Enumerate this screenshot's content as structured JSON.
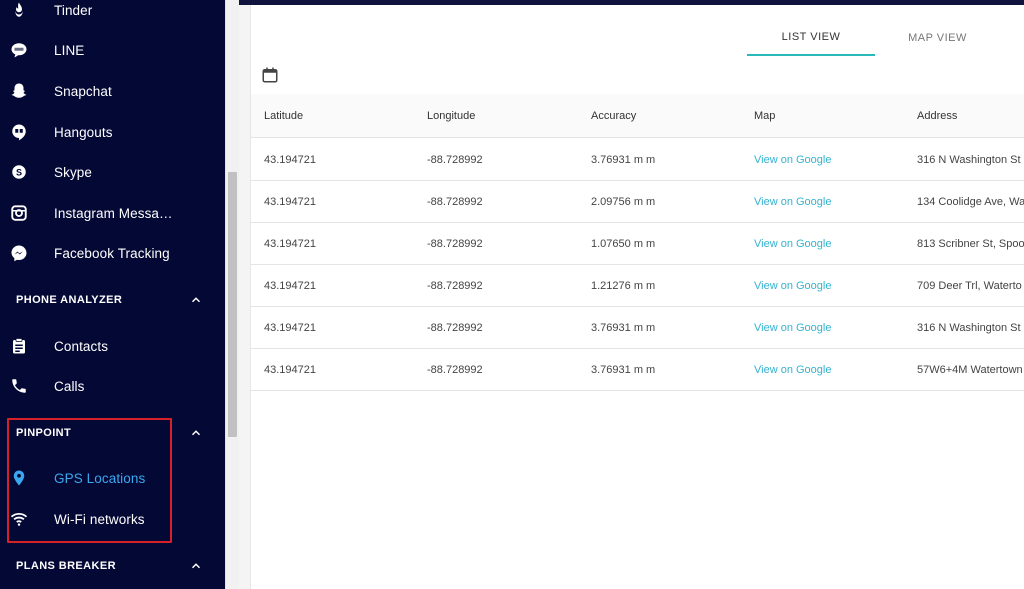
{
  "sidebar": {
    "apps": [
      {
        "label": "Tinder",
        "icon": "tinder-flame-icon"
      },
      {
        "label": "LINE",
        "icon": "line-bubble-icon"
      },
      {
        "label": "Snapchat",
        "icon": "snapchat-ghost-icon"
      },
      {
        "label": "Hangouts",
        "icon": "hangouts-quote-icon"
      },
      {
        "label": "Skype",
        "icon": "skype-icon"
      },
      {
        "label": "Instagram Messa…",
        "icon": "instagram-icon"
      },
      {
        "label": "Facebook Tracking",
        "icon": "messenger-icon"
      }
    ],
    "phone_analyzer": {
      "title": "PHONE ANALYZER",
      "items": [
        {
          "label": "Contacts",
          "icon": "clipboard-icon"
        },
        {
          "label": "Calls",
          "icon": "phone-icon"
        }
      ]
    },
    "pinpoint": {
      "title": "PINPOINT",
      "items": [
        {
          "label": "GPS Locations",
          "icon": "map-pin-icon",
          "active": true
        },
        {
          "label": "Wi-Fi networks",
          "icon": "wifi-icon"
        }
      ]
    },
    "plans_breaker": {
      "title": "PLANS BREAKER"
    },
    "colors": {
      "background": "#040835",
      "active": "#3aa8f0",
      "highlight": "#d8202b"
    }
  },
  "tabs": [
    {
      "label": "LIST VIEW",
      "active": true
    },
    {
      "label": "MAP VIEW",
      "active": false
    }
  ],
  "calendar_icon": "calendar-icon",
  "table": {
    "headers": [
      "Latitude",
      "Longitude",
      "Accuracy",
      "Map",
      "Address"
    ],
    "rows": [
      [
        "43.194721",
        "-88.728992",
        "3.76931 m m",
        "View on Google",
        "316 N Washington St"
      ],
      [
        "43.194721",
        "-88.728992",
        "2.09756 m m",
        "View on Google",
        "134 Coolidge Ave, Wa"
      ],
      [
        "43.194721",
        "-88.728992",
        "1.07650 m m",
        "View on Google",
        "813 Scribner St, Spoo"
      ],
      [
        "43.194721",
        "-88.728992",
        "1.21276 m m",
        "View on Google",
        "709 Deer Trl, Waterto"
      ],
      [
        "43.194721",
        "-88.728992",
        "3.76931 m m",
        "View on Google",
        "316 N Washington St"
      ],
      [
        "43.194721",
        "-88.728992",
        "3.76931 m m",
        "View on Google",
        "57W6+4M Watertown"
      ]
    ],
    "link_color": "#35b3cf",
    "tab_accent": "#2ab8b8"
  }
}
